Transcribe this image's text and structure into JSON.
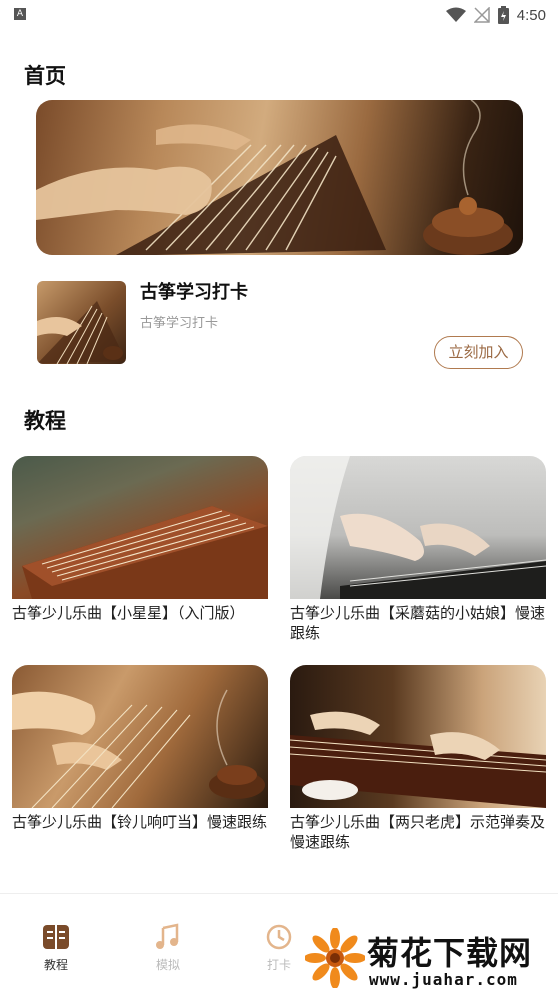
{
  "status_bar": {
    "time": "4:50",
    "left_icon": "A"
  },
  "home": {
    "title": "首页"
  },
  "checkin": {
    "title": "古筝学习打卡",
    "subtitle": "古筝学习打卡",
    "join_label": "立刻加入"
  },
  "tutorials": {
    "title": "教程",
    "items": [
      {
        "title": "古筝少儿乐曲【小星星】（入门版）"
      },
      {
        "title": "古筝少儿乐曲【采蘑菇的小姑娘】慢速跟练"
      },
      {
        "title": "古筝少儿乐曲【铃儿响叮当】慢速跟练"
      },
      {
        "title": "古筝少儿乐曲【两只老虎】示范弹奏及慢速跟练"
      }
    ]
  },
  "bottom_nav": {
    "items": [
      {
        "label": "教程",
        "icon": "book-icon"
      },
      {
        "label": "模拟",
        "icon": "music-note-icon"
      },
      {
        "label": "打卡",
        "icon": "clock-icon"
      }
    ]
  },
  "watermark": {
    "brand": "菊花下载网",
    "url": "www.juahar.com"
  },
  "colors": {
    "accent": "#9b6a44",
    "accent_border": "#b07a4f",
    "nav_active": "#7a4b2a"
  }
}
